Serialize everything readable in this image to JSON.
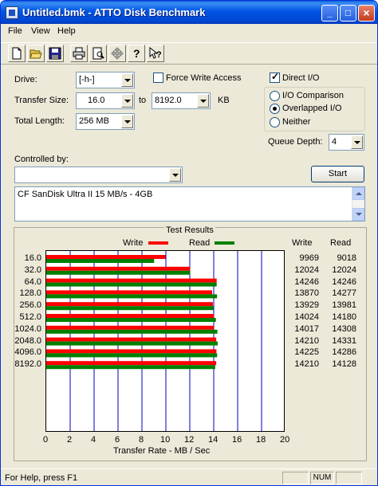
{
  "window": {
    "title": "Untitled.bmk - ATTO Disk Benchmark",
    "minimize_label": "_",
    "maximize_label": "□",
    "close_label": "×"
  },
  "menu": [
    "File",
    "View",
    "Help"
  ],
  "toolbar_icons": [
    "new-icon",
    "open-icon",
    "save-icon",
    "print-icon",
    "print-preview-icon",
    "move-icon",
    "help-icon",
    "context-help-icon"
  ],
  "form": {
    "drive_label": "Drive:",
    "drive_value": "[-h-]",
    "force_write_label": "Force Write Access",
    "force_write_checked": false,
    "direct_io_label": "Direct I/O",
    "direct_io_checked": true,
    "transfer_size_label": "Transfer Size:",
    "transfer_from": "16.0",
    "to_label": "to",
    "transfer_to": "8192.0",
    "kb_label": "KB",
    "total_length_label": "Total Length:",
    "total_length_value": "256 MB",
    "io_options": [
      "I/O Comparison",
      "Overlapped I/O",
      "Neither"
    ],
    "io_selected": "Overlapped I/O",
    "queue_depth_label": "Queue Depth:",
    "queue_depth_value": "4",
    "controlled_by_label": "Controlled by:",
    "controlled_by_value": "",
    "start_label": "Start",
    "description": "CF SanDisk Ultra II 15 MB/s - 4GB"
  },
  "results": {
    "title": "Test Results",
    "write_legend": "Write",
    "read_legend": "Read",
    "write_col": "Write",
    "read_col": "Read",
    "write_values": [
      "9969",
      "12024",
      "14246",
      "13870",
      "13929",
      "14024",
      "14017",
      "14210",
      "14225",
      "14210"
    ],
    "read_values": [
      "9018",
      "12024",
      "14246",
      "14277",
      "13981",
      "14180",
      "14308",
      "14331",
      "14286",
      "14128"
    ]
  },
  "chart_data": {
    "type": "bar",
    "orientation": "horizontal",
    "categories": [
      "16.0",
      "32.0",
      "64.0",
      "128.0",
      "256.0",
      "512.0",
      "1024.0",
      "2048.0",
      "4096.0",
      "8192.0"
    ],
    "series": [
      {
        "name": "Write",
        "color": "#ff0000",
        "values": [
          9.969,
          12.024,
          14.246,
          13.87,
          13.929,
          14.024,
          14.017,
          14.21,
          14.225,
          14.21
        ]
      },
      {
        "name": "Read",
        "color": "#008000",
        "values": [
          9.018,
          12.024,
          14.246,
          14.277,
          13.981,
          14.18,
          14.308,
          14.331,
          14.286,
          14.128
        ]
      }
    ],
    "xlim": [
      0,
      20
    ],
    "x_ticks": [
      "0",
      "2",
      "4",
      "6",
      "8",
      "10",
      "12",
      "14",
      "16",
      "18",
      "20"
    ],
    "xlabel": "Transfer Rate - MB / Sec",
    "grid_color": "#0000c0",
    "legend": "top"
  },
  "status": {
    "help_text": "For Help, press F1",
    "num": "NUM"
  }
}
